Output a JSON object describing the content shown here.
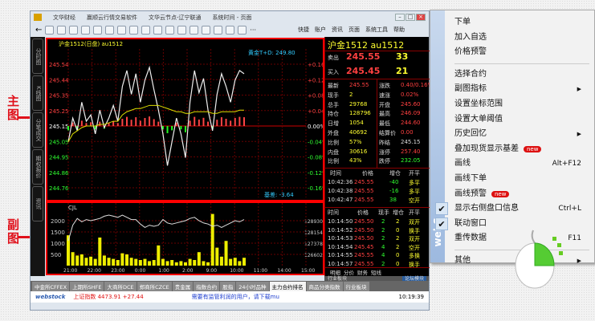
{
  "window": {
    "title_parts": [
      "文华财经",
      "赢顺云行情交易软件",
      "文华云节点-辽宁联通",
      "系统时间 - 页面"
    ],
    "menu": [
      "快捷",
      "账户",
      "资讯",
      "页面",
      "系统工具",
      "帮助"
    ]
  },
  "sidebar_tabs": [
    "分时图",
    "K线图",
    "分笔成交",
    "期权报价",
    "资讯"
  ],
  "main_chart": {
    "header": "沪金1512(日盘) au1512",
    "ref_label": "黄金T+D: 249.80",
    "bottom_label": "基差: -3.64"
  },
  "sub_chart": {
    "label": "CJL"
  },
  "chart_data": {
    "type": "line",
    "title": "沪金1512 分时",
    "price_ticks": [
      "245.54",
      "245.44",
      "245.35",
      "245.25",
      "245.15",
      "245.05",
      "244.95",
      "244.86",
      "244.76"
    ],
    "pct_ticks": [
      "+0.16%",
      "+0.12%",
      "+0.08%",
      "+0.04%",
      "0.00%",
      "-0.04%",
      "-0.08%",
      "-0.12%",
      "-0.16%"
    ],
    "ylim": [
      244.76,
      245.54
    ],
    "prev_settle": 245.15,
    "price": [
      245.05,
      245.2,
      245.12,
      245.3,
      245.18,
      245.22,
      245.1,
      245.25,
      245.14,
      245.2,
      245.28,
      245.18,
      245.4,
      245.5,
      245.35,
      245.48,
      245.3,
      245.44,
      245.52,
      245.38,
      245.25,
      245.1,
      244.9,
      245.05,
      245.2,
      245.1,
      244.95,
      245.3,
      245.5,
      245.36,
      245.45,
      245.25,
      245.12,
      245.35,
      245.48,
      245.4,
      245.3,
      245.44,
      245.5,
      245.48
    ],
    "avg": [
      245.05,
      245.1,
      245.12,
      245.14,
      245.15,
      245.15,
      245.15,
      245.16,
      245.16,
      245.17,
      245.18,
      245.18,
      245.22,
      245.24,
      245.25,
      245.26,
      245.26,
      245.27,
      245.28,
      245.28,
      245.28,
      245.27,
      245.26,
      245.25,
      245.24,
      245.24,
      245.23,
      245.23,
      245.24,
      245.24,
      245.24,
      245.24,
      245.23,
      245.23,
      245.24,
      245.24,
      245.24,
      245.24,
      245.25,
      245.25
    ],
    "vol_ticks": [
      "2000",
      "1500",
      "1000",
      "500"
    ],
    "oi_ticks": [
      "128930",
      "128154",
      "127378",
      "126602"
    ],
    "x_ticks": [
      "21:00",
      "22:00",
      "23:00",
      "0:00",
      "1:00",
      "2:00",
      "9:00",
      "10:00",
      "11:00",
      "14:00",
      "15:00"
    ],
    "volume": [
      1350,
      600,
      450,
      500,
      350,
      400,
      300,
      1250,
      450,
      350,
      300,
      250,
      550,
      500,
      350,
      300,
      250,
      300,
      200,
      250,
      900,
      300,
      200,
      250,
      150,
      200,
      150,
      300,
      250,
      600,
      200,
      150,
      2300,
      800,
      400,
      1100,
      300,
      350,
      200,
      350
    ],
    "oi_line": [
      1100,
      1800,
      2100,
      1950,
      2050,
      2000,
      2050,
      2100,
      2200,
      2250,
      2200,
      2150,
      2250,
      2150,
      2050,
      2050,
      1850,
      1700,
      1800,
      1750,
      1800,
      2050,
      1900,
      1850,
      1900,
      1950,
      2000,
      2100,
      2150,
      2000,
      1900,
      1850,
      1750,
      1800,
      1700,
      1800,
      1900,
      2000,
      1950,
      2050
    ]
  },
  "quote": {
    "name": "沪金1512",
    "code": "au1512",
    "sell_label": "卖出",
    "sell_price": "245.55",
    "sell_vol": "33",
    "buy_label": "买入",
    "buy_price": "245.45",
    "buy_vol": "21",
    "left": [
      [
        "最新",
        "245.55"
      ],
      [
        "现手",
        "2"
      ],
      [
        "总手",
        "29768"
      ],
      [
        "持仓",
        "128796"
      ],
      [
        "日增",
        "1054"
      ],
      [
        "外盘",
        "40692"
      ],
      [
        "比例",
        "57%"
      ],
      [
        "内盘",
        "30616"
      ],
      [
        "比例",
        "43%"
      ]
    ],
    "right": [
      [
        "涨跌",
        "0.40/0.16%"
      ],
      [
        "速涨",
        "0.02%"
      ],
      [
        "开盘",
        "245.60"
      ],
      [
        "最高",
        "246.09"
      ],
      [
        "最低",
        "244.60"
      ],
      [
        "结算价",
        "0.00"
      ],
      [
        "昨结",
        "245.15"
      ],
      [
        "涨停",
        "257.40"
      ],
      [
        "跌停",
        "232.05"
      ]
    ]
  },
  "trades1": {
    "headers": [
      "时间",
      "价格",
      "增仓",
      "开平"
    ],
    "rows": [
      [
        "10:42:36",
        "245.55",
        "-40",
        "多平"
      ],
      [
        "10:42:38",
        "245.55",
        "-16",
        "多平"
      ],
      [
        "10:42:47",
        "245.55",
        "38",
        "空开"
      ]
    ]
  },
  "trades2": {
    "headers": [
      "时间",
      "价格",
      "现手",
      "增仓",
      "开平"
    ],
    "rows": [
      [
        "10:14:50",
        "245.50",
        "2",
        "2",
        "双开"
      ],
      [
        "10:14:52",
        "245.50",
        "2",
        "0",
        "换手"
      ],
      [
        "10:14:53",
        "245.50",
        "2",
        "2",
        "双开"
      ],
      [
        "10:14:54",
        "245.45",
        "4",
        "2",
        "空开"
      ],
      [
        "10:14:55",
        "245.55",
        "4",
        "0",
        "多换"
      ],
      [
        "10:14:57",
        "245.55",
        "2",
        "0",
        "换手"
      ]
    ]
  },
  "right_tabs": [
    "明细",
    "分价",
    "财务",
    "短线"
  ],
  "right_footer": {
    "left": "行业板块",
    "button": "论坛模块"
  },
  "bottom_tabs": [
    "中金所CFFEX",
    "上期所SHFE",
    "大商所DCE",
    "郑商所CZCE",
    "贵金属",
    "指数合约",
    "股指",
    "24小时品种",
    "主力合约排名",
    "商品分类指数",
    "行业板块"
  ],
  "status": {
    "logo": "webstock",
    "index": "上证指数 4473.91 +27.44",
    "notice": "需要有监管利润的用户，请下载mu",
    "time": "10:19:39"
  },
  "context_menu": {
    "items": [
      {
        "label": "下单"
      },
      {
        "label": "加入自选"
      },
      {
        "label": "价格预警"
      },
      {
        "sep": true
      },
      {
        "label": "选择合约"
      },
      {
        "label": "副图指标",
        "sub": true
      },
      {
        "label": "设置坐标范围"
      },
      {
        "label": "设置大单阈值"
      },
      {
        "label": "历史回忆",
        "sub": true
      },
      {
        "label": "叠加现货显示基差",
        "badge": "new"
      },
      {
        "label": "画线",
        "shortcut": "Alt+F12"
      },
      {
        "label": "画线下单"
      },
      {
        "label": "画线预警",
        "badge": "new"
      },
      {
        "label": "显示右侧盘口信息",
        "shortcut": "Ctrl+L",
        "checked": true
      },
      {
        "label": "联动窗口",
        "checked": true
      },
      {
        "label": "重传数据",
        "shortcut": "F11"
      },
      {
        "sep": true
      },
      {
        "label": "其他",
        "sub": true
      }
    ],
    "strip_text": "webS"
  },
  "annotations": {
    "main": "主图",
    "sub": "副图"
  }
}
